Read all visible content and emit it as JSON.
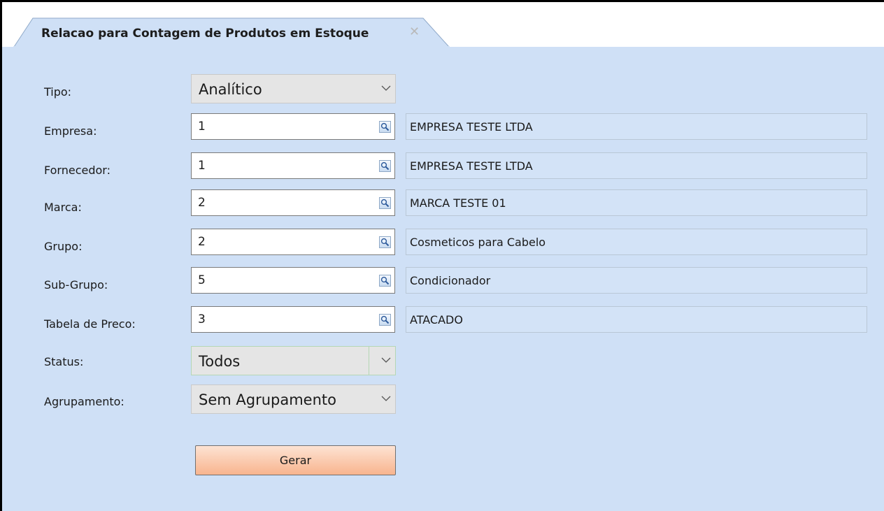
{
  "tab": {
    "title": "Relacao para Contagem de Produtos em Estoque"
  },
  "form": {
    "tipo": {
      "label": "Tipo:",
      "value": "Analítico"
    },
    "empresa": {
      "label": "Empresa:",
      "code": "1",
      "description": "EMPRESA TESTE LTDA"
    },
    "fornecedor": {
      "label": "Fornecedor:",
      "code": "1",
      "description": "EMPRESA TESTE LTDA"
    },
    "marca": {
      "label": "Marca:",
      "code": "2",
      "description": "MARCA TESTE 01"
    },
    "grupo": {
      "label": "Grupo:",
      "code": "2",
      "description": "Cosmeticos para Cabelo"
    },
    "subgrupo": {
      "label": "Sub-Grupo:",
      "code": "5",
      "description": "Condicionador"
    },
    "tabela_preco": {
      "label": "Tabela de Preco:",
      "code": "3",
      "description": "ATACADO"
    },
    "status": {
      "label": "Status:",
      "value": "Todos"
    },
    "agrupamento": {
      "label": "Agrupamento:",
      "value": "Sem Agrupamento"
    }
  },
  "actions": {
    "generate_label": "Gerar"
  },
  "icons": {
    "tab_close": "close-icon",
    "lookup": "magnifier-icon",
    "dropdown": "chevron-down-icon"
  },
  "colors": {
    "panel_bg": "#cfe0f6",
    "button_gradient_top": "#fde3d3",
    "button_gradient_bottom": "#f8b48e"
  }
}
